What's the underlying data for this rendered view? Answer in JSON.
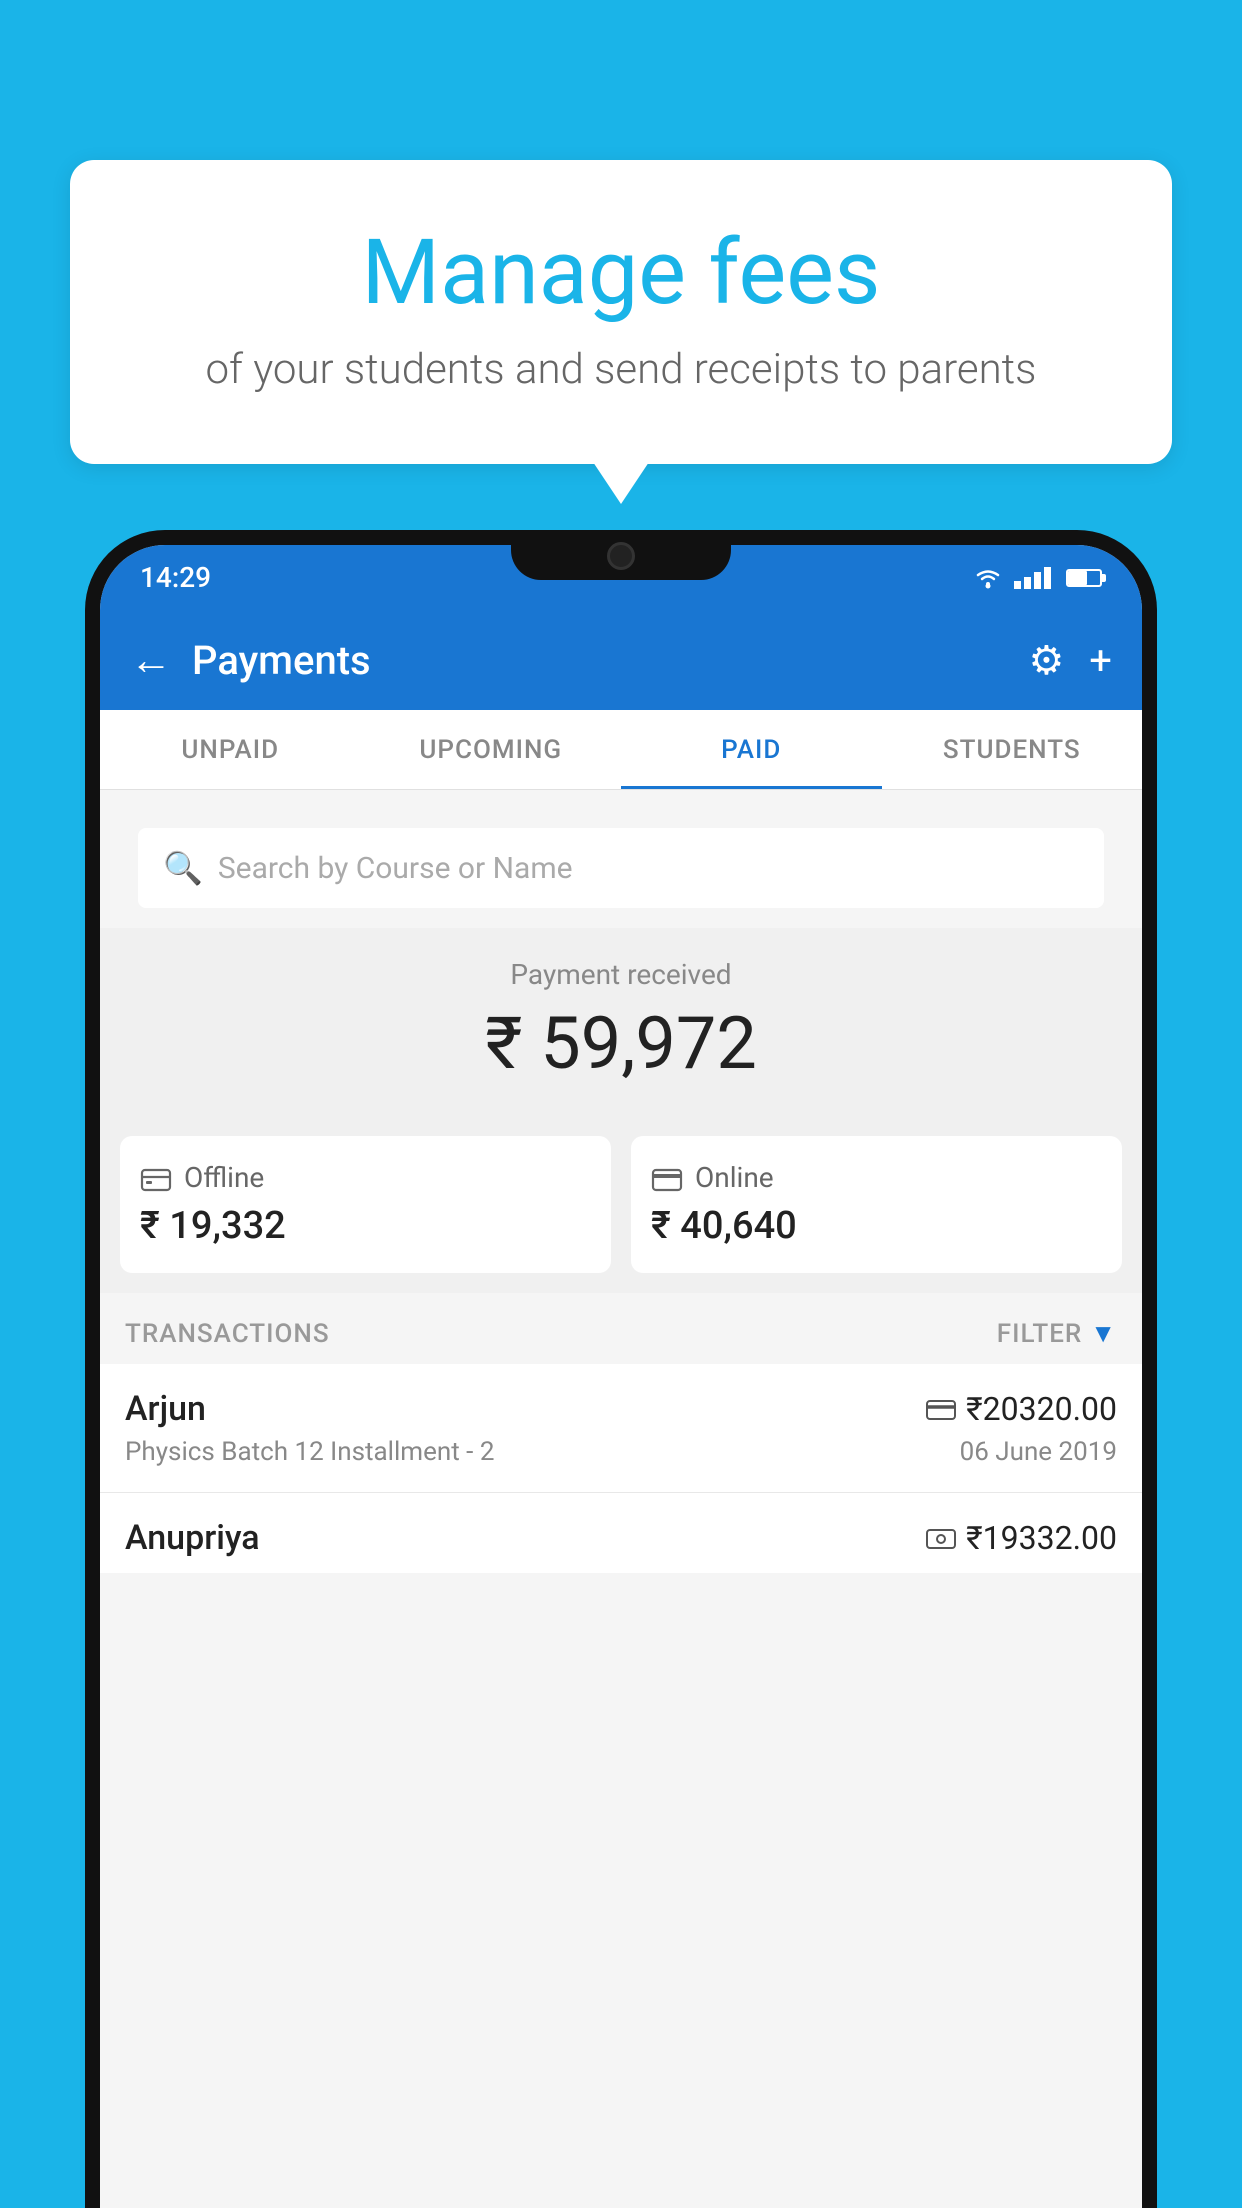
{
  "background": {
    "color": "#1ab4e8"
  },
  "bubble": {
    "title": "Manage fees",
    "subtitle": "of your students and send receipts to parents"
  },
  "phone": {
    "status_bar": {
      "time": "14:29"
    },
    "app_bar": {
      "title": "Payments",
      "back_label": "←",
      "gear_label": "⚙",
      "plus_label": "+"
    },
    "tabs": [
      {
        "label": "UNPAID",
        "active": false
      },
      {
        "label": "UPCOMING",
        "active": false
      },
      {
        "label": "PAID",
        "active": true
      },
      {
        "label": "STUDENTS",
        "active": false
      }
    ],
    "search": {
      "placeholder": "Search by Course or Name"
    },
    "payment_summary": {
      "label": "Payment received",
      "amount": "₹ 59,972"
    },
    "cards": [
      {
        "icon": "💳",
        "label": "Offline",
        "amount": "₹ 19,332"
      },
      {
        "icon": "💳",
        "label": "Online",
        "amount": "₹ 40,640"
      }
    ],
    "transactions": {
      "header_label": "TRANSACTIONS",
      "filter_label": "FILTER"
    },
    "transaction_rows": [
      {
        "name": "Arjun",
        "amount": "₹20320.00",
        "detail": "Physics Batch 12 Installment - 2",
        "date": "06 June 2019",
        "icon": "💳"
      },
      {
        "name": "Anupriya",
        "amount": "₹19332.00",
        "icon": "💴"
      }
    ]
  }
}
